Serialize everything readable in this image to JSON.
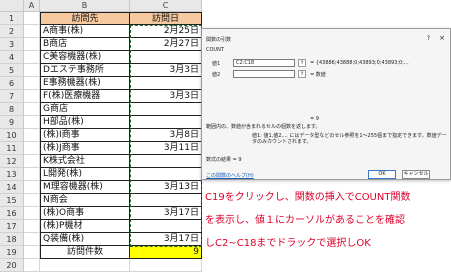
{
  "columns": [
    "A",
    "B",
    "C"
  ],
  "rows": [
    "1",
    "2",
    "3",
    "4",
    "5",
    "6",
    "7",
    "8",
    "9",
    "10",
    "11",
    "12",
    "13",
    "14",
    "15",
    "16",
    "17",
    "18",
    "19",
    "20"
  ],
  "table": {
    "header": [
      "訪問先",
      "訪問日"
    ],
    "entries": [
      {
        "name": "A商事(株)",
        "date": "2月25日"
      },
      {
        "name": "B商店",
        "date": "2月27日"
      },
      {
        "name": "C美容機器(株)",
        "date": ""
      },
      {
        "name": "Dエステ事務所",
        "date": "3月3日"
      },
      {
        "name": "E事務機器(株)",
        "date": ""
      },
      {
        "name": "F(株)医療機器",
        "date": "3月3日"
      },
      {
        "name": "G商店",
        "date": ""
      },
      {
        "name": "H部品(株)",
        "date": ""
      },
      {
        "name": "(株)I商事",
        "date": "3月8日"
      },
      {
        "name": "(株)J商事",
        "date": "3月11日"
      },
      {
        "name": "K株式会社",
        "date": ""
      },
      {
        "name": "L開発(株)",
        "date": ""
      },
      {
        "name": "M理容機器(株)",
        "date": "3月13日"
      },
      {
        "name": "N商会",
        "date": ""
      },
      {
        "name": "(株)O商事",
        "date": "3月17日"
      },
      {
        "name": "(株)P機材",
        "date": ""
      },
      {
        "name": "Q装備(株)",
        "date": "3月17日"
      }
    ],
    "total_label": "訪問件数",
    "total_value": "9"
  },
  "dialog": {
    "title": "関数の引数",
    "help_glyph": "?",
    "close_glyph": "×",
    "function_name": "COUNT",
    "arg1_label": "値1",
    "arg1_value": "C2:C18",
    "arg1_result": "= {43886;43888;0;43893;0;43893;0;...",
    "arg2_label": "値2",
    "arg2_result": "= 数値",
    "ref_glyph": "↑",
    "equals_result": "= 9",
    "description": "範囲内の、数値が含まれるセルの個数を返します。",
    "arg_help": "値1: 値1,値2,... にはデータ型などのセル参照を1〜255個まで指定できます。数値データのみカウントされます。",
    "formula_result": "数式の結果 = 9",
    "help_link": "この関数のヘルプ(H)",
    "ok_label": "OK",
    "cancel_label": "キャンセル"
  },
  "annotation": {
    "lines": [
      "C19をクリックし、関数の挿入でCOUNT関数",
      "を表示し、値１にカーソルがあることを確認",
      "しC2~C18までドラックで選択しOK"
    ]
  },
  "colors": {
    "header_fill": "#f6c9a0",
    "total_fill": "#ffff00",
    "note_text": "#e0002a"
  }
}
